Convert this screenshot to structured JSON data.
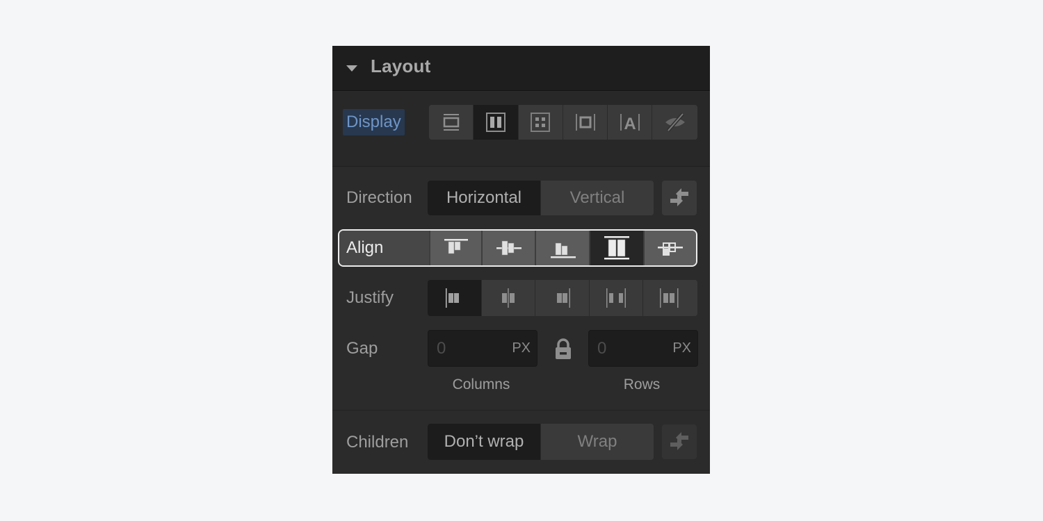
{
  "panel": {
    "title": "Layout",
    "collapse_icon": "caret-down-icon"
  },
  "display": {
    "label": "Display",
    "options": [
      {
        "name": "block",
        "icon": "display-block-icon",
        "active": false
      },
      {
        "name": "flex",
        "icon": "display-flex-icon",
        "active": true
      },
      {
        "name": "grid",
        "icon": "display-grid-icon",
        "active": false
      },
      {
        "name": "inline-block",
        "icon": "display-inline-block-icon",
        "active": false
      },
      {
        "name": "inline",
        "icon": "display-inline-icon",
        "active": false
      },
      {
        "name": "none",
        "icon": "display-none-icon",
        "active": false
      }
    ]
  },
  "direction": {
    "label": "Direction",
    "options": [
      "Horizontal",
      "Vertical"
    ],
    "selected": "Horizontal",
    "reverse_icon": "reverse-arrows-icon"
  },
  "align": {
    "label": "Align",
    "options": [
      {
        "name": "start",
        "icon": "align-start-icon",
        "active": false
      },
      {
        "name": "center",
        "icon": "align-center-icon",
        "active": false
      },
      {
        "name": "end",
        "icon": "align-end-icon",
        "active": false
      },
      {
        "name": "stretch",
        "icon": "align-stretch-icon",
        "active": true
      },
      {
        "name": "baseline",
        "icon": "align-baseline-icon",
        "active": false
      }
    ]
  },
  "justify": {
    "label": "Justify",
    "options": [
      {
        "name": "start",
        "icon": "justify-start-icon",
        "active": true
      },
      {
        "name": "center",
        "icon": "justify-center-icon",
        "active": false
      },
      {
        "name": "end",
        "icon": "justify-end-icon",
        "active": false
      },
      {
        "name": "space-between",
        "icon": "justify-space-between-icon",
        "active": false
      },
      {
        "name": "space-around",
        "icon": "justify-space-around-icon",
        "active": false
      }
    ]
  },
  "gap": {
    "label": "Gap",
    "columns": {
      "placeholder": "0",
      "unit": "PX",
      "caption": "Columns"
    },
    "rows": {
      "placeholder": "0",
      "unit": "PX",
      "caption": "Rows"
    },
    "lock_icon": "lock-icon"
  },
  "children": {
    "label": "Children",
    "options": [
      "Don’t wrap",
      "Wrap"
    ],
    "selected": "Don’t wrap",
    "reverse_icon": "reverse-arrows-icon"
  },
  "colors": {
    "panel_bg": "#2b2b2b",
    "header_bg": "#1e1e1e",
    "active_bg": "#1c1c1c",
    "accent_label_bg": "#27384f",
    "accent_label_text": "#6f95c7",
    "focus_outline": "#ececec"
  }
}
